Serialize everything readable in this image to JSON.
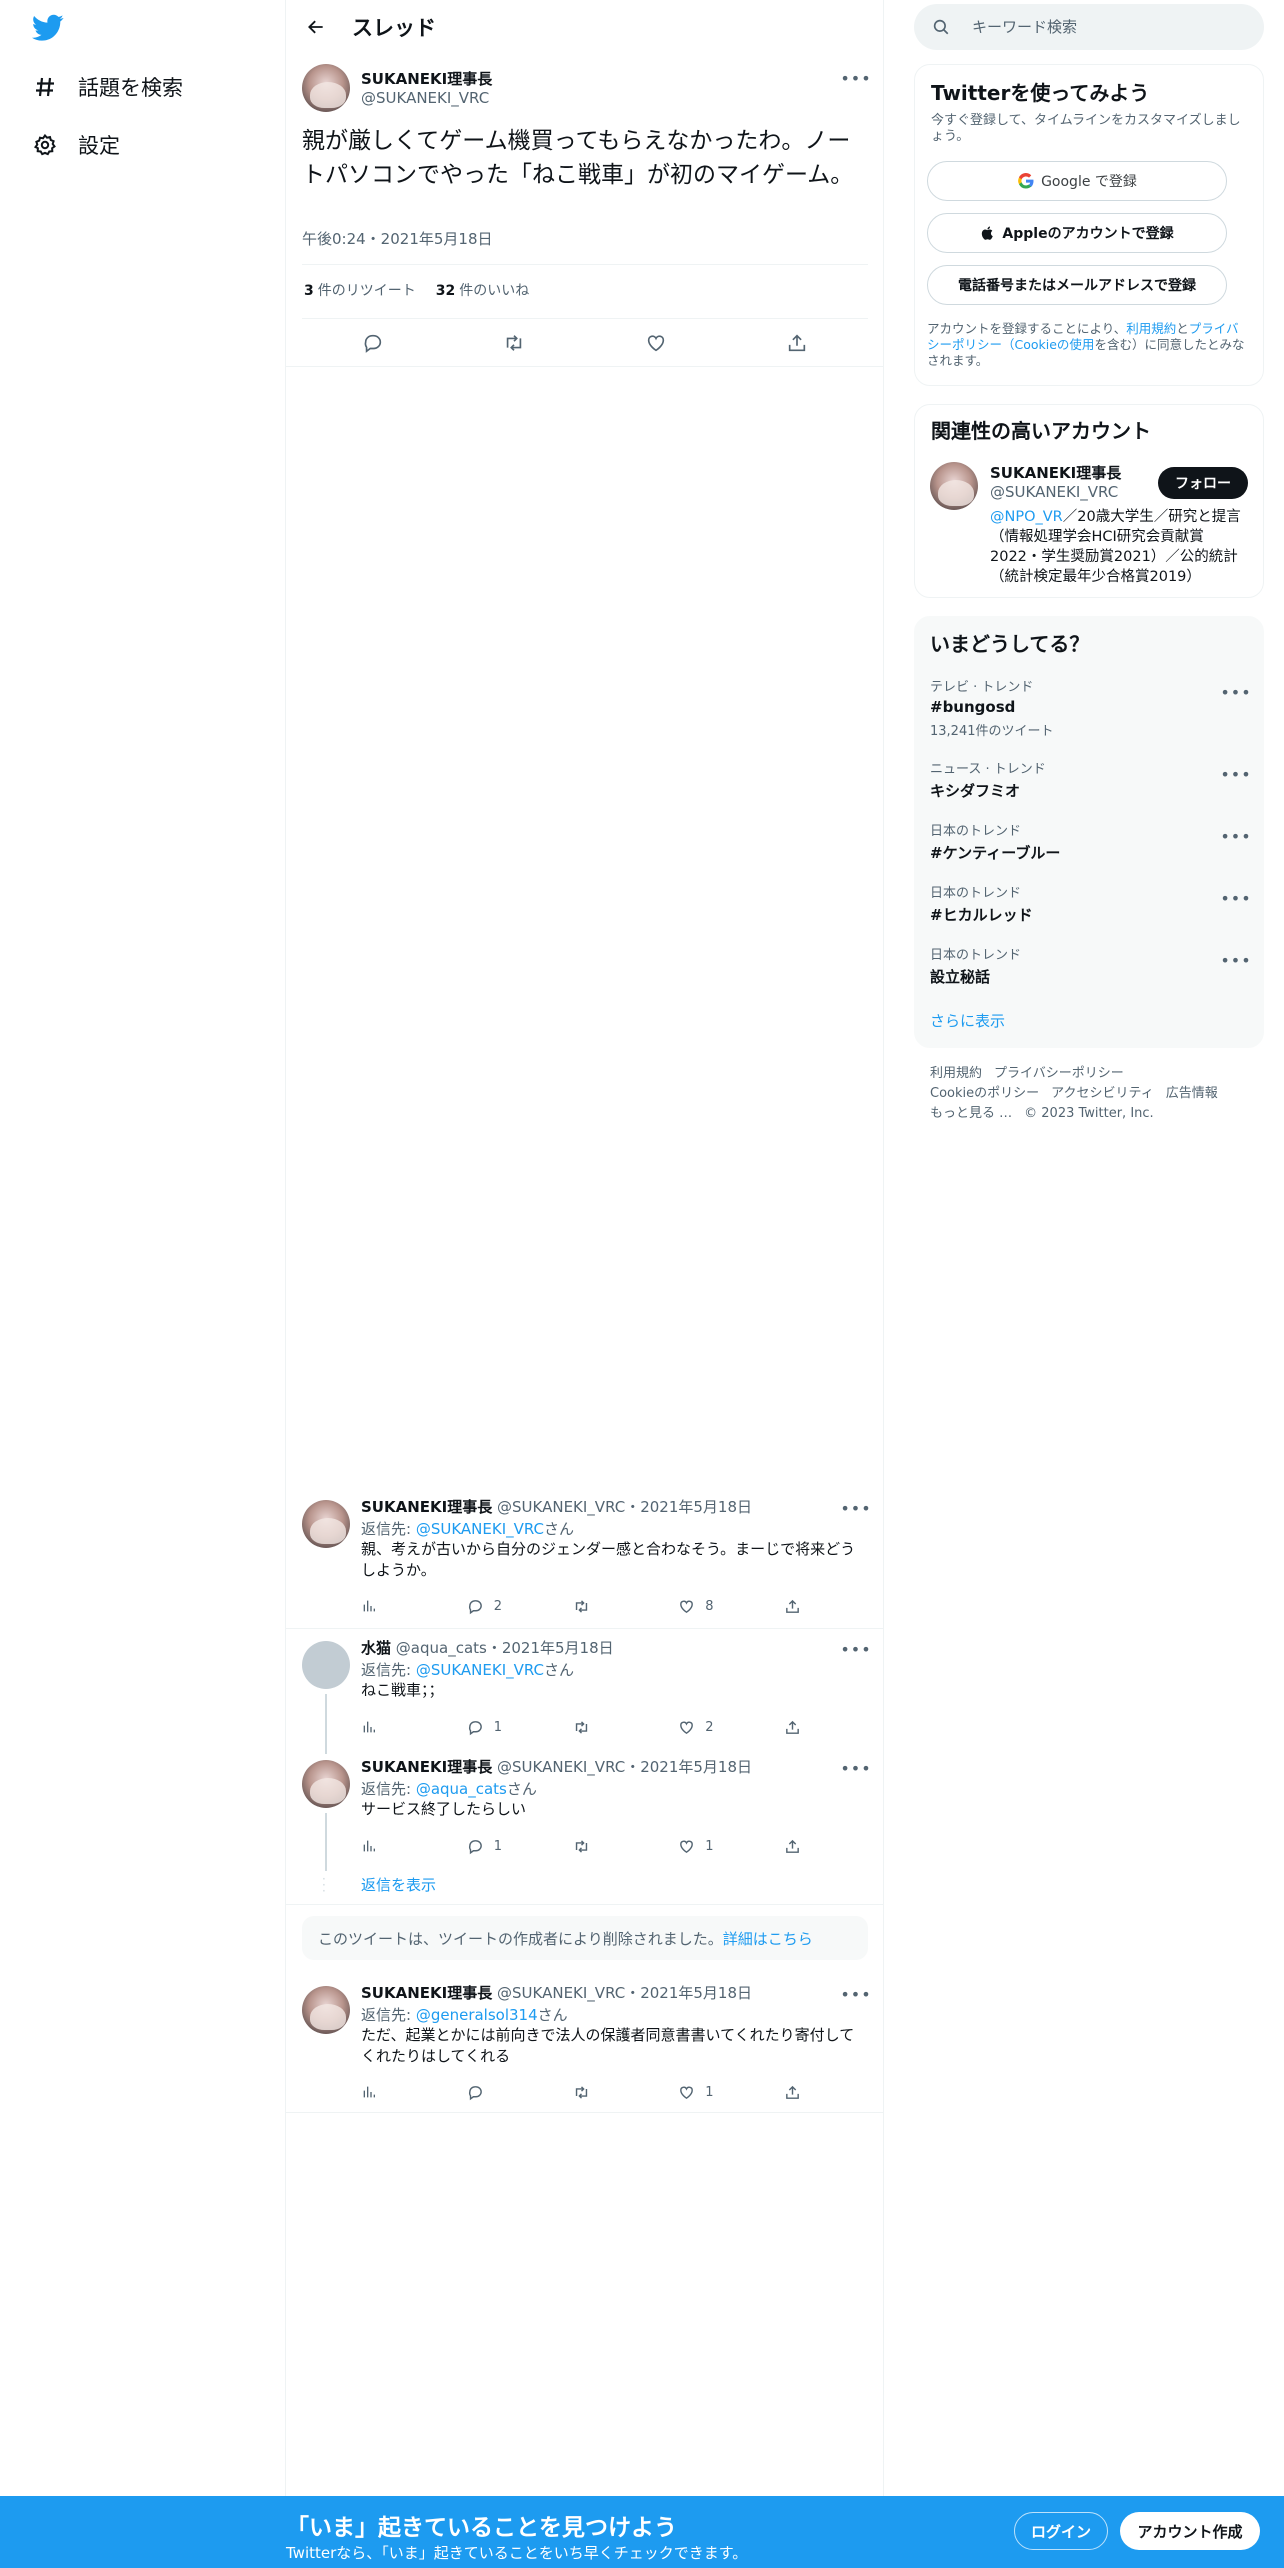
{
  "nav": {
    "explore_label": "話題を検索",
    "settings_label": "設定"
  },
  "header": {
    "title": "スレッド"
  },
  "main_tweet": {
    "name": "SUKANEKI理事長",
    "handle": "@SUKANEKI_VRC",
    "text": "親が厳しくてゲーム機買ってもらえなかったわ。ノートパソコンでやった「ねこ戦車」が初のマイゲーム。",
    "time": "午後0:24・2021年5月18日",
    "retweets_count": "3",
    "retweets_label": "件のリツイート",
    "likes_count": "32",
    "likes_label": "件のいいね"
  },
  "replies": [
    {
      "name": "SUKANEKI理事長",
      "meta": "@SUKANEKI_VRC・2021年5月18日",
      "reply_to_prefix": "返信先: ",
      "reply_to": "@SUKANEKI_VRC",
      "reply_to_suffix": "さん",
      "text": "親、考えが古いから自分のジェンダー感と合わなそう。まーじで将来どうしようか。",
      "replies": "2",
      "retweets": "",
      "likes": "8"
    },
    {
      "name": "水猫",
      "meta": "@aqua_cats・2021年5月18日",
      "reply_to_prefix": "返信先: ",
      "reply_to": "@SUKANEKI_VRC",
      "reply_to_suffix": "さん",
      "text": "ねこ戦車；；",
      "replies": "1",
      "retweets": "",
      "likes": "2"
    },
    {
      "name": "SUKANEKI理事長",
      "meta": "@SUKANEKI_VRC・2021年5月18日",
      "reply_to_prefix": "返信先: ",
      "reply_to": "@aqua_cats",
      "reply_to_suffix": "さん",
      "text": "サービス終了したらしい",
      "replies": "1",
      "retweets": "",
      "likes": "1"
    },
    {
      "name": "SUKANEKI理事長",
      "meta": "@SUKANEKI_VRC・2021年5月18日",
      "reply_to_prefix": "返信先: ",
      "reply_to": "@generalsol314",
      "reply_to_suffix": "さん",
      "text": "ただ、起業とかには前向きで法人の保護者同意書書いてくれたり寄付してくれたりはしてくれる",
      "replies": "",
      "retweets": "",
      "likes": "1"
    }
  ],
  "show_replies_label": "返信を表示",
  "deleted_notice": {
    "text": "このツイートは、ツイートの作成者により削除されました。",
    "link": "詳細はこちら"
  },
  "search": {
    "placeholder": "キーワード検索"
  },
  "signup_card": {
    "title": "Twitterを使ってみよう",
    "subtitle": "今すぐ登録して、タイムラインをカスタマイズしましょう。",
    "google_label": "Google で登録",
    "apple_label": "Appleのアカウントで登録",
    "phone_label": "電話番号またはメールアドレスで登録",
    "legal_prefix": "アカウントを登録することにより、",
    "legal_terms": "利用規約",
    "legal_and": "と",
    "legal_privacy": "プライバシーポリシー（Cookieの使用",
    "legal_suffix": "を含む）に同意したとみなされます。"
  },
  "relevant": {
    "title": "関連性の高いアカウント",
    "name": "SUKANEKI理事長",
    "handle": "@SUKANEKI_VRC",
    "follow_label": "フォロー",
    "bio_mention": "@NPO_VR",
    "bio_text": "／20歳大学生／研究と提言（情報処理学会HCI研究会貢献賞2022・学生奨励賞2021）／公的統計（統計検定最年少合格賞2019）"
  },
  "trends": {
    "title": "いまどうしてる？",
    "items": [
      {
        "category": "テレビ · トレンド",
        "name": "#bungosd",
        "count": "13,241件のツイート"
      },
      {
        "category": "ニュース · トレンド",
        "name": "キシダフミオ",
        "count": ""
      },
      {
        "category": "日本のトレンド",
        "name": "#ケンティーブルー",
        "count": ""
      },
      {
        "category": "日本のトレンド",
        "name": "#ヒカルレッド",
        "count": ""
      },
      {
        "category": "日本のトレンド",
        "name": "設立秘話",
        "count": ""
      }
    ],
    "show_more": "さらに表示"
  },
  "footer": {
    "terms": "利用規約",
    "privacy": "プライバシーポリシー",
    "cookie": "Cookieのポリシー",
    "accessibility": "アクセシビリティ",
    "ads": "広告情報",
    "more": "もっと見る …",
    "copyright": "© 2023 Twitter, Inc."
  },
  "bottom_bar": {
    "title": "「いま」起きていることを見つけよう",
    "subtitle": "Twitterなら、「いま」起きていることをいち早くチェックできます。",
    "login_label": "ログイン",
    "signup_label": "アカウント作成"
  },
  "colors": {
    "accent": "#1d9bf0",
    "text": "#0f1419",
    "muted": "#536471"
  }
}
